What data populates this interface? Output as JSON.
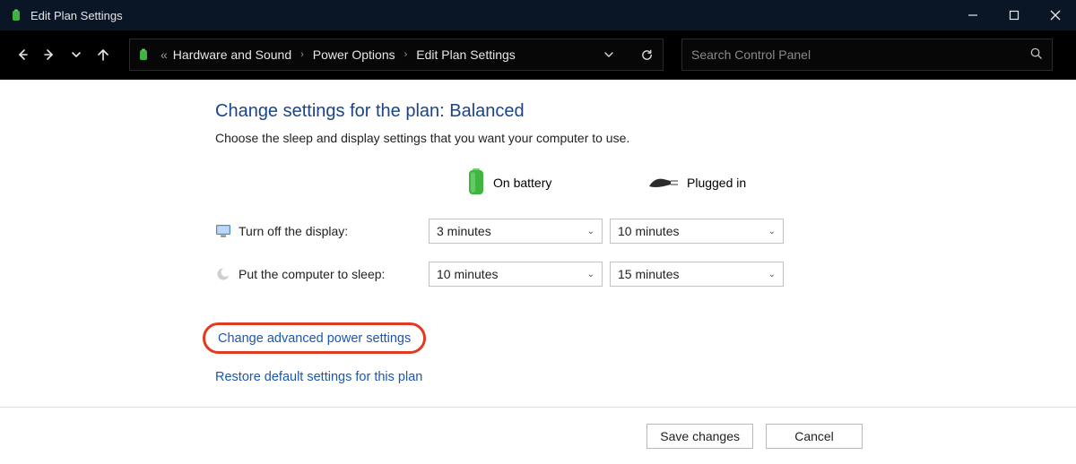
{
  "window": {
    "title": "Edit Plan Settings"
  },
  "breadcrumbs": {
    "prefix": "«",
    "items": [
      "Hardware and Sound",
      "Power Options",
      "Edit Plan Settings"
    ]
  },
  "search": {
    "placeholder": "Search Control Panel"
  },
  "page": {
    "heading": "Change settings for the plan: Balanced",
    "subtext": "Choose the sleep and display settings that you want your computer to use."
  },
  "columns": {
    "battery": "On battery",
    "plugged": "Plugged in"
  },
  "rows": {
    "display_label": "Turn off the display:",
    "sleep_label": "Put the computer to sleep:"
  },
  "values": {
    "display_battery": "3 minutes",
    "display_plugged": "10 minutes",
    "sleep_battery": "10 minutes",
    "sleep_plugged": "15 minutes"
  },
  "links": {
    "advanced": "Change advanced power settings",
    "restore": "Restore default settings for this plan"
  },
  "buttons": {
    "save": "Save changes",
    "cancel": "Cancel"
  }
}
